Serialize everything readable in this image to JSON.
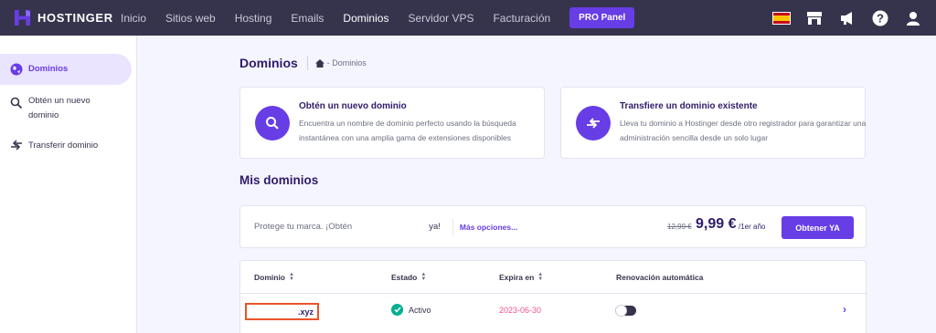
{
  "brand": {
    "name": "HOSTINGER"
  },
  "nav": {
    "items": [
      {
        "label": "Inicio"
      },
      {
        "label": "Sitios web"
      },
      {
        "label": "Hosting"
      },
      {
        "label": "Emails"
      },
      {
        "label": "Dominios",
        "active": true
      },
      {
        "label": "Servidor VPS"
      },
      {
        "label": "Facturación"
      }
    ],
    "pro_label": "PRO Panel",
    "right_icons": [
      "spain-flag-icon",
      "store-icon",
      "megaphone-icon",
      "help-icon",
      "user-icon"
    ]
  },
  "sidebar": {
    "items": [
      {
        "label": "Dominios",
        "icon": "globe-icon",
        "active": true
      },
      {
        "label": "Obtén un nuevo dominio",
        "icon": "search-icon"
      },
      {
        "label": "Transferir dominio",
        "icon": "transfer-icon"
      }
    ]
  },
  "page": {
    "title": "Dominios",
    "breadcrumb": "- Dominios"
  },
  "promos": [
    {
      "title": "Obtén un nuevo dominio",
      "desc": "Encuentra un nombre de dominio perfecto usando la búsqueda instantánea con una amplia gama de extensiones disponibles",
      "icon": "search-icon"
    },
    {
      "title": "Transfiere un dominio existente",
      "desc": "Lleva tu dominio a Hostinger desde otro registrador para garantizar una administración sencilla desde un solo lugar",
      "icon": "transfer-icon"
    }
  ],
  "section": {
    "title": "Mis dominios"
  },
  "offer": {
    "text": "Protege tu marca. ¡Obtén",
    "suffix": "ya!",
    "more": "Más opciones...",
    "old_price": "12,99 €",
    "price": "9,99 €",
    "per": "/1er año",
    "button": "Obtener YA"
  },
  "table": {
    "headers": [
      "Dominio",
      "Estado",
      "Expira en",
      "Renovación automática"
    ],
    "rows": [
      {
        "domain": ".xyz",
        "status": "Activo",
        "expires": "2023-06-30",
        "auto_renew": false
      }
    ]
  },
  "colors": {
    "accent": "#673de6",
    "nav_bg": "#36344d",
    "expiry": "#fc5185",
    "success": "#00b090"
  }
}
